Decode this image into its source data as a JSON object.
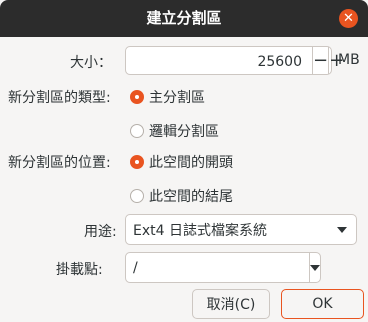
{
  "window": {
    "title": "建立分割區",
    "close_glyph": "✕"
  },
  "size": {
    "label": "大小：",
    "value": "25600",
    "minus": "−",
    "plus": "+",
    "unit": "MB"
  },
  "partition_type": {
    "label": "新分割區的類型:",
    "options": [
      {
        "label": "主分割區",
        "checked": true
      },
      {
        "label": "邏輯分割區",
        "checked": false
      }
    ]
  },
  "partition_location": {
    "label": "新分割區的位置:",
    "options": [
      {
        "label": "此空間的開頭",
        "checked": true
      },
      {
        "label": "此空間的結尾",
        "checked": false
      }
    ]
  },
  "use_as": {
    "label": "用途:",
    "selected": "Ext4 日誌式檔案系統"
  },
  "mount_point": {
    "label": "掛載點:",
    "value": "/"
  },
  "buttons": {
    "cancel": "取消(C)",
    "ok": "OK"
  },
  "colors": {
    "accent": "#e95420",
    "titlebar": "#2c2c2c",
    "background": "#f6f5f4"
  }
}
